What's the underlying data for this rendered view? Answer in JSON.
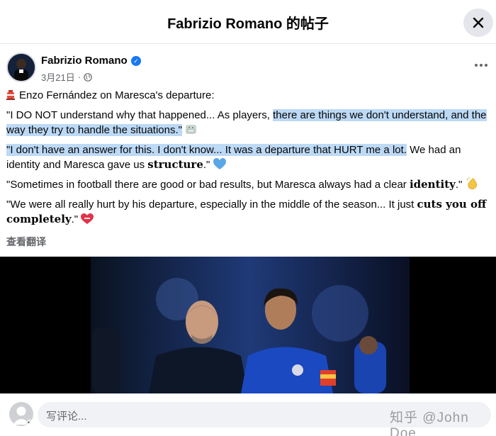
{
  "modal": {
    "title": "Fabrizio Romano 的帖子",
    "close_icon": "close-icon"
  },
  "post": {
    "author": "Fabrizio Romano",
    "verified_icon": "verified-badge-icon",
    "date": "3月21日",
    "separator": "·",
    "privacy_icon": "globe-icon",
    "more_icon": "more-options-icon",
    "lead_icon": "red-buoy-icon",
    "headline": "Enzo Fernández on Maresca's departure:",
    "q1_plain": "\"I DO NOT understand why that happened... As players, ",
    "q1_hl": "there are things we don't understand, and the way they try to handle the situations.\"",
    "q1_emoji_icon": "grimacing-face-icon",
    "q2_hl": "\"I don't have an answer for this. I don't know... It was a departure that HURT me a lot.",
    "q2_plain": " We had an identity and Maresca gave us ",
    "q2_bold": "structure",
    "q2_end": ".\"",
    "q2_emoji_icon": "blue-heart-icon",
    "q3_plain": "\"Sometimes in football there are good or bad results, but Maresca always had a clear ",
    "q3_bold": "identity",
    "q3_end": ".\"",
    "q3_emoji_icon": "clapping-hands-icon",
    "q4_plain": "\"We were all really hurt by his departure, especially in the middle of the season... It just ",
    "q4_bold": "cuts you off completely",
    "q4_end": ".\"",
    "q4_emoji_icon": "mending-heart-icon",
    "translate": "查看翻译"
  },
  "media": {
    "photo": "photo-manager-and-player"
  },
  "comment": {
    "avatar_icon": "user-avatar-icon",
    "placeholder": "写评论...",
    "watermark": "知乎 @John Doe"
  },
  "colors": {
    "highlight": "#bcd9f5",
    "verified": "#1877f2",
    "muted": "#65676b",
    "divider": "#e4e6eb"
  }
}
